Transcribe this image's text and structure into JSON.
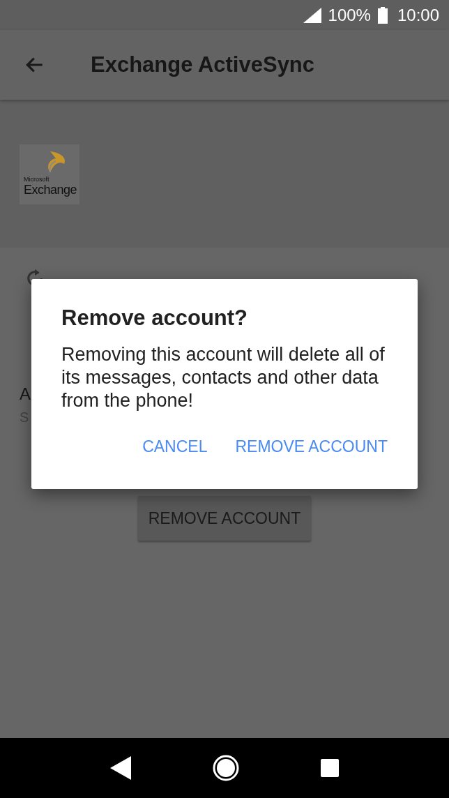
{
  "status_bar": {
    "battery": "100%",
    "time": "10:00"
  },
  "app_bar": {
    "title": "Exchange ActiveSync"
  },
  "account_logo": {
    "brand_small": "Microsoft",
    "brand": "Exchange"
  },
  "settings": [
    {
      "kind": "sync"
    },
    {
      "kind": "plain",
      "title": "A",
      "subtitle": "S"
    }
  ],
  "remove_button": {
    "label": "REMOVE ACCOUNT"
  },
  "dialog": {
    "title": "Remove account?",
    "message": "Removing this account will delete all of its messages, contacts and other data from the phone!",
    "buttons": [
      {
        "label": "CANCEL"
      },
      {
        "label": "REMOVE ACCOUNT"
      }
    ]
  }
}
